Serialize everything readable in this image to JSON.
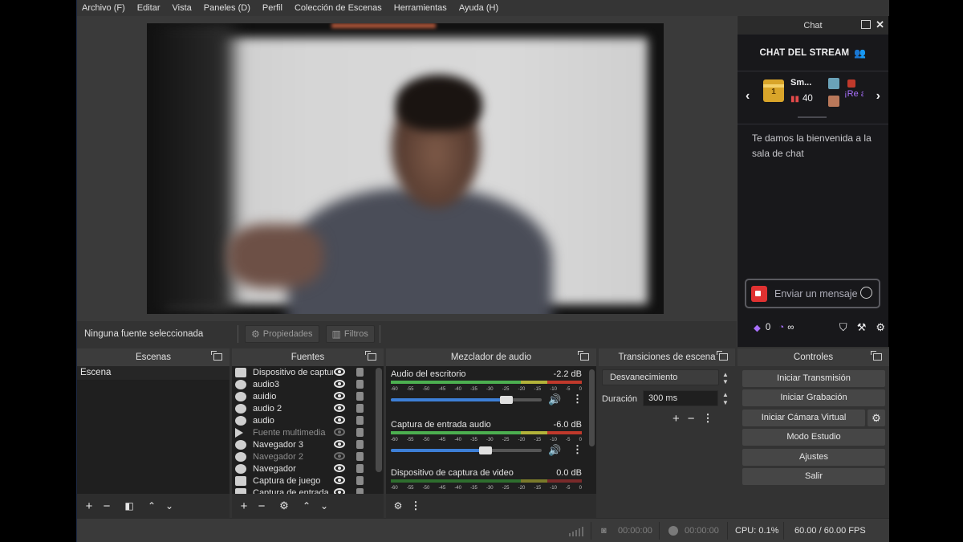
{
  "menu": [
    "Archivo (F)",
    "Editar",
    "Vista",
    "Paneles (D)",
    "Perfil",
    "Colección de Escenas",
    "Herramientas",
    "Ayuda (H)"
  ],
  "preview": {
    "status_text": "Ninguna fuente seleccionada",
    "properties_label": "Propiedades",
    "filters_label": "Filtros"
  },
  "chat": {
    "title": "Chat",
    "header": "CHAT DEL STREAM",
    "gift": {
      "badge": "1",
      "name": "Sm...",
      "count": "40",
      "message": "¡Re alca"
    },
    "welcome": "Te damos la bienvenida a la sala de chat",
    "input_placeholder": "Enviar un mensaje",
    "points": "0",
    "infinity": "∞"
  },
  "docks": {
    "scenes": {
      "title": "Escenas",
      "items": [
        "Escena"
      ]
    },
    "sources": {
      "title": "Fuentes",
      "items": [
        {
          "name": "Dispositivo de captura",
          "icon": "camera-icon",
          "visible": true
        },
        {
          "name": "audio3",
          "icon": "globe-icon",
          "visible": true
        },
        {
          "name": "auidio",
          "icon": "globe-icon",
          "visible": true
        },
        {
          "name": "audio 2",
          "icon": "globe-icon",
          "visible": true
        },
        {
          "name": "audio",
          "icon": "globe-icon",
          "visible": true
        },
        {
          "name": "Fuente multimedia",
          "icon": "play-icon",
          "visible": false
        },
        {
          "name": "Navegador 3",
          "icon": "globe-icon",
          "visible": true
        },
        {
          "name": "Navegador 2",
          "icon": "globe-icon",
          "visible": false
        },
        {
          "name": "Navegador",
          "icon": "globe-icon",
          "visible": true
        },
        {
          "name": "Captura de juego",
          "icon": "gamepad-icon",
          "visible": true
        },
        {
          "name": "Captura de entrada",
          "icon": "mic-icon",
          "visible": true
        }
      ]
    },
    "mixer": {
      "title": "Mezclador de audio",
      "scale": [
        "-60",
        "-55",
        "-50",
        "-45",
        "-40",
        "-35",
        "-30",
        "-25",
        "-20",
        "-15",
        "-10",
        "-5",
        "0"
      ],
      "channels": [
        {
          "name": "Audio del escritorio",
          "db": "-2.2 dB",
          "volume": 0.8
        },
        {
          "name": "Captura de entrada audio",
          "db": "-6.0 dB",
          "volume": 0.66
        },
        {
          "name": "Dispositivo de captura de video",
          "db": "0.0 dB",
          "volume": 1.0
        }
      ]
    },
    "transitions": {
      "title": "Transiciones de escena",
      "selected": "Desvanecimiento",
      "duration_label": "Duración",
      "duration_value": "300 ms"
    },
    "controls": {
      "title": "Controles",
      "buttons": [
        "Iniciar Transmisión",
        "Iniciar Grabación",
        "Iniciar Cámara Virtual",
        "Modo Estudio",
        "Ajustes",
        "Salir"
      ]
    }
  },
  "statusbar": {
    "stream_time": "00:00:00",
    "rec_time": "00:00:00",
    "cpu": "CPU: 0.1%",
    "fps": "60.00 / 60.00 FPS"
  },
  "colors": {
    "accent_blue": "#3d7fd6",
    "twitch_purple": "#a970ff",
    "chat_bg": "#18181b",
    "panel_bg": "#2d2d2d"
  }
}
